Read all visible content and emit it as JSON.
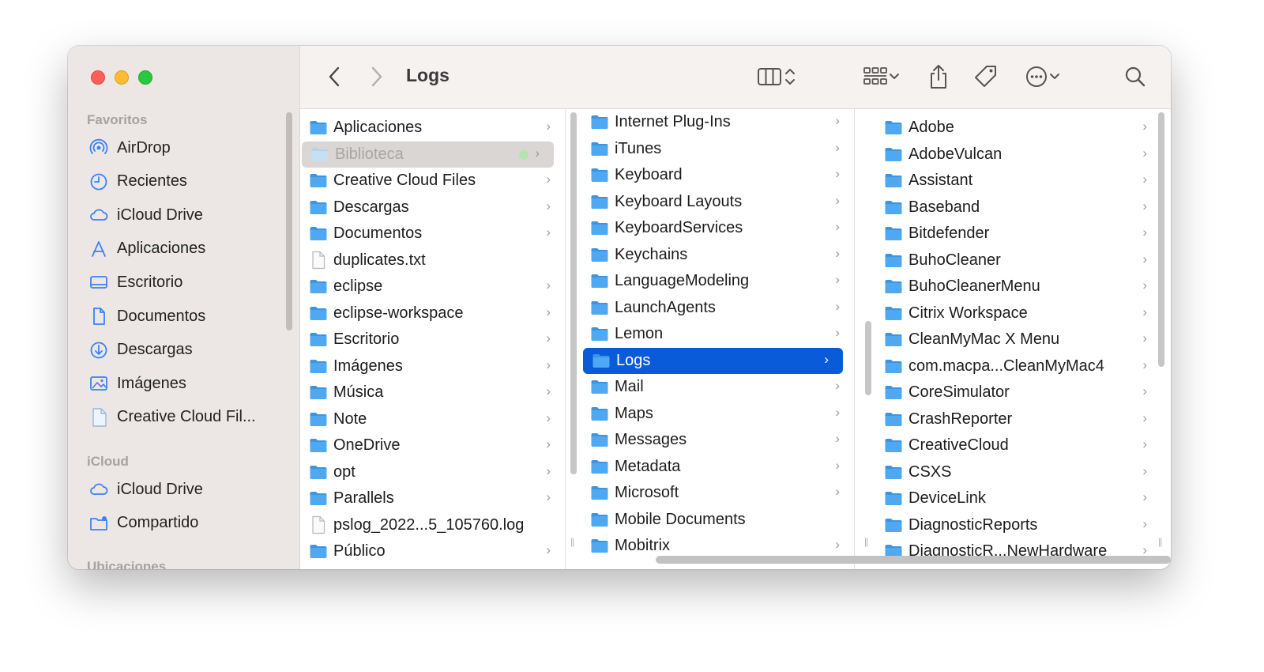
{
  "window": {
    "title": "Logs"
  },
  "sidebar": {
    "favorites_header": "Favoritos",
    "favorites": [
      {
        "label": "AirDrop",
        "icon": "airdrop-icon"
      },
      {
        "label": "Recientes",
        "icon": "clock-icon"
      },
      {
        "label": "iCloud Drive",
        "icon": "cloud-icon"
      },
      {
        "label": "Aplicaciones",
        "icon": "apps-icon"
      },
      {
        "label": "Escritorio",
        "icon": "desktop-icon"
      },
      {
        "label": "Documentos",
        "icon": "document-icon"
      },
      {
        "label": "Descargas",
        "icon": "download-icon"
      },
      {
        "label": "Imágenes",
        "icon": "photo-icon"
      },
      {
        "label": "Creative Cloud Fil...",
        "icon": "file-icon"
      }
    ],
    "icloud_header": "iCloud",
    "icloud": [
      {
        "label": "iCloud Drive",
        "icon": "cloud-icon"
      },
      {
        "label": "Compartido",
        "icon": "shared-folder-icon"
      }
    ],
    "locations_header": "Ubicaciones"
  },
  "columns": {
    "col1": [
      {
        "label": "Aplicaciones",
        "kind": "folder",
        "chev": true
      },
      {
        "label": "Biblioteca",
        "kind": "folder",
        "chev": true,
        "state": "dim"
      },
      {
        "label": "Creative Cloud Files",
        "kind": "folder",
        "chev": true
      },
      {
        "label": "Descargas",
        "kind": "folder",
        "chev": true
      },
      {
        "label": "Documentos",
        "kind": "folder",
        "chev": true
      },
      {
        "label": "duplicates.txt",
        "kind": "file",
        "chev": false
      },
      {
        "label": "eclipse",
        "kind": "folder",
        "chev": true
      },
      {
        "label": "eclipse-workspace",
        "kind": "folder",
        "chev": true
      },
      {
        "label": "Escritorio",
        "kind": "folder",
        "chev": true
      },
      {
        "label": "Imágenes",
        "kind": "folder",
        "chev": true
      },
      {
        "label": "Música",
        "kind": "folder",
        "chev": true
      },
      {
        "label": "Note",
        "kind": "folder",
        "chev": true
      },
      {
        "label": "OneDrive",
        "kind": "folder",
        "chev": true
      },
      {
        "label": "opt",
        "kind": "folder",
        "chev": true
      },
      {
        "label": "Parallels",
        "kind": "folder",
        "chev": true
      },
      {
        "label": "pslog_2022...5_105760.log",
        "kind": "file",
        "chev": false
      },
      {
        "label": "Público",
        "kind": "folder",
        "chev": true
      }
    ],
    "col2": [
      {
        "label": "Internet Plug-Ins",
        "kind": "folder",
        "chev": true
      },
      {
        "label": "iTunes",
        "kind": "folder",
        "chev": true
      },
      {
        "label": "Keyboard",
        "kind": "folder",
        "chev": true
      },
      {
        "label": "Keyboard Layouts",
        "kind": "folder",
        "chev": true
      },
      {
        "label": "KeyboardServices",
        "kind": "folder",
        "chev": true
      },
      {
        "label": "Keychains",
        "kind": "folder",
        "chev": true
      },
      {
        "label": "LanguageModeling",
        "kind": "folder",
        "chev": true
      },
      {
        "label": "LaunchAgents",
        "kind": "folder",
        "chev": true
      },
      {
        "label": "Lemon",
        "kind": "folder",
        "chev": true
      },
      {
        "label": "Logs",
        "kind": "folder",
        "chev": true,
        "state": "sel"
      },
      {
        "label": "Mail",
        "kind": "folder",
        "chev": true
      },
      {
        "label": "Maps",
        "kind": "folder",
        "chev": true
      },
      {
        "label": "Messages",
        "kind": "folder",
        "chev": true
      },
      {
        "label": "Metadata",
        "kind": "folder",
        "chev": true
      },
      {
        "label": "Microsoft",
        "kind": "folder",
        "chev": true
      },
      {
        "label": "Mobile Documents",
        "kind": "folder",
        "chev": false
      },
      {
        "label": "Mobitrix",
        "kind": "folder",
        "chev": true
      }
    ],
    "col3": [
      {
        "label": "Adobe",
        "kind": "folder",
        "chev": true
      },
      {
        "label": "AdobeVulcan",
        "kind": "folder",
        "chev": true
      },
      {
        "label": "Assistant",
        "kind": "folder",
        "chev": true
      },
      {
        "label": "Baseband",
        "kind": "folder",
        "chev": true
      },
      {
        "label": "Bitdefender",
        "kind": "folder",
        "chev": true
      },
      {
        "label": "BuhoCleaner",
        "kind": "folder",
        "chev": true
      },
      {
        "label": "BuhoCleanerMenu",
        "kind": "folder",
        "chev": true
      },
      {
        "label": "Citrix Workspace",
        "kind": "folder",
        "chev": true
      },
      {
        "label": "CleanMyMac X Menu",
        "kind": "folder",
        "chev": true
      },
      {
        "label": "com.macpa...CleanMyMac4",
        "kind": "folder",
        "chev": true
      },
      {
        "label": "CoreSimulator",
        "kind": "folder",
        "chev": true
      },
      {
        "label": "CrashReporter",
        "kind": "folder",
        "chev": true
      },
      {
        "label": "CreativeCloud",
        "kind": "folder",
        "chev": true
      },
      {
        "label": "CSXS",
        "kind": "folder",
        "chev": true
      },
      {
        "label": "DeviceLink",
        "kind": "folder",
        "chev": true
      },
      {
        "label": "DiagnosticReports",
        "kind": "folder",
        "chev": true
      },
      {
        "label": "DiagnosticR...NewHardware",
        "kind": "folder",
        "chev": true
      }
    ]
  },
  "colors": {
    "selection": "#0a5bd9",
    "folder": "#4ea9f2",
    "sidebar_icon": "#3a82f7"
  }
}
